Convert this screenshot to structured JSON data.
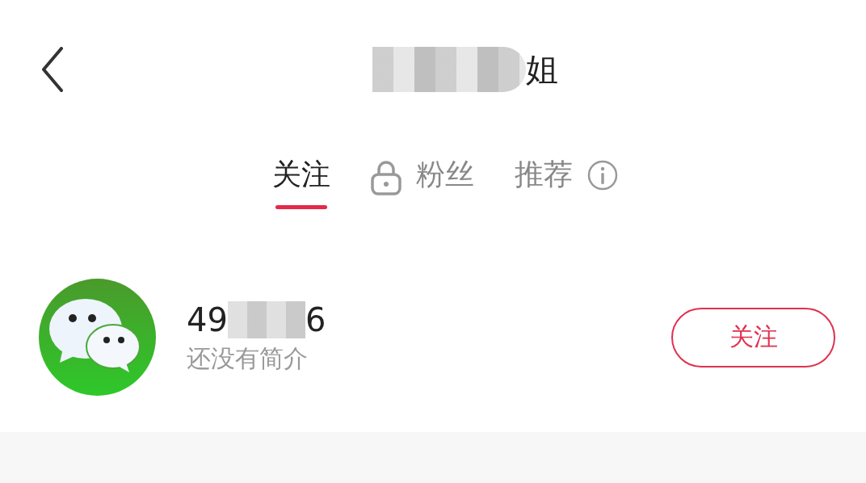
{
  "header": {
    "title_visible": "姐"
  },
  "tabs": [
    {
      "label": "关注",
      "selected": true,
      "kind": "plain"
    },
    {
      "label": "粉丝",
      "selected": false,
      "kind": "locked"
    },
    {
      "label": "推荐",
      "selected": false,
      "kind": "info"
    }
  ],
  "users": [
    {
      "name_start": "49",
      "name_end": "6",
      "bio": "还没有简介",
      "button": "关注"
    }
  ]
}
